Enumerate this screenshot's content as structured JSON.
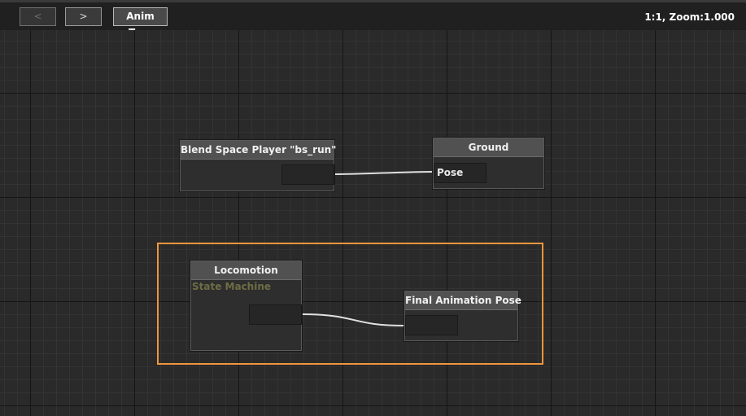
{
  "toolbar": {
    "prev_label": "<",
    "next_label": ">",
    "tree_label": "Anim Tree",
    "zoom_readout": "1:1, Zoom:1.000"
  },
  "nodes": {
    "blend_space": {
      "title": "Blend Space Player \"bs_run\""
    },
    "ground": {
      "title": "Ground",
      "input_label": "Pose"
    },
    "locomotion": {
      "title": "Locomotion",
      "subtitle": "State Machine"
    },
    "final_pose": {
      "title": "Final Animation Pose"
    }
  },
  "colors": {
    "selection": "#f0963c",
    "link": "#e0e0e0"
  }
}
